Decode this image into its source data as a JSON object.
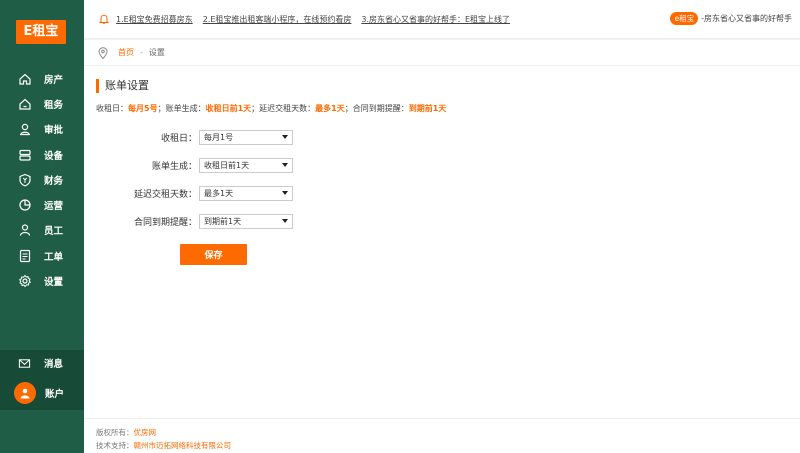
{
  "brand": {
    "logo": "E租宝",
    "accent": "#ff6a00",
    "sidebar_bg": "#1f5d46"
  },
  "topbar": {
    "notices": [
      "1.E租宝免费招募房东",
      "2.E租宝推出租客端小程序，在线预约看房",
      "3.房东省心又省事的好帮手：E租宝上线了"
    ],
    "pill": "e租宝",
    "tagline": "-房东省心又省事的好帮手"
  },
  "breadcrumb": {
    "home": "首页",
    "sep": "-",
    "current": "设置"
  },
  "sidebar": {
    "items": [
      {
        "label": "房产",
        "icon": "house-icon"
      },
      {
        "label": "租务",
        "icon": "home-key-icon"
      },
      {
        "label": "审批",
        "icon": "user-check-icon"
      },
      {
        "label": "设备",
        "icon": "device-icon"
      },
      {
        "label": "财务",
        "icon": "shield-yen-icon"
      },
      {
        "label": "运营",
        "icon": "pie-chart-icon"
      },
      {
        "label": "员工",
        "icon": "person-icon"
      },
      {
        "label": "工单",
        "icon": "document-icon"
      },
      {
        "label": "设置",
        "icon": "gear-icon"
      }
    ],
    "message": "消息",
    "account": "账户"
  },
  "main": {
    "title": "账单设置",
    "summary": [
      {
        "k": "收租日：",
        "v": "每月5号"
      },
      {
        "k": "；账单生成：",
        "v": "收租日前1天"
      },
      {
        "k": "；延迟交租天数：",
        "v": "最多1天"
      },
      {
        "k": "；合同到期提醒：",
        "v": "到期前1天"
      }
    ],
    "form": [
      {
        "label": "收租日：",
        "value": "每月1号"
      },
      {
        "label": "账单生成：",
        "value": "收租日前1天"
      },
      {
        "label": "延迟交租天数：",
        "value": "最多1天"
      },
      {
        "label": "合同到期提醒：",
        "value": "到期前1天"
      }
    ],
    "save_label": "保存"
  },
  "footer": {
    "copyright_label": "版权所有：",
    "copyright_value": "优房网",
    "support_label": "技术支持：",
    "support_value": "赣州市迈拓网络科技有限公司"
  }
}
